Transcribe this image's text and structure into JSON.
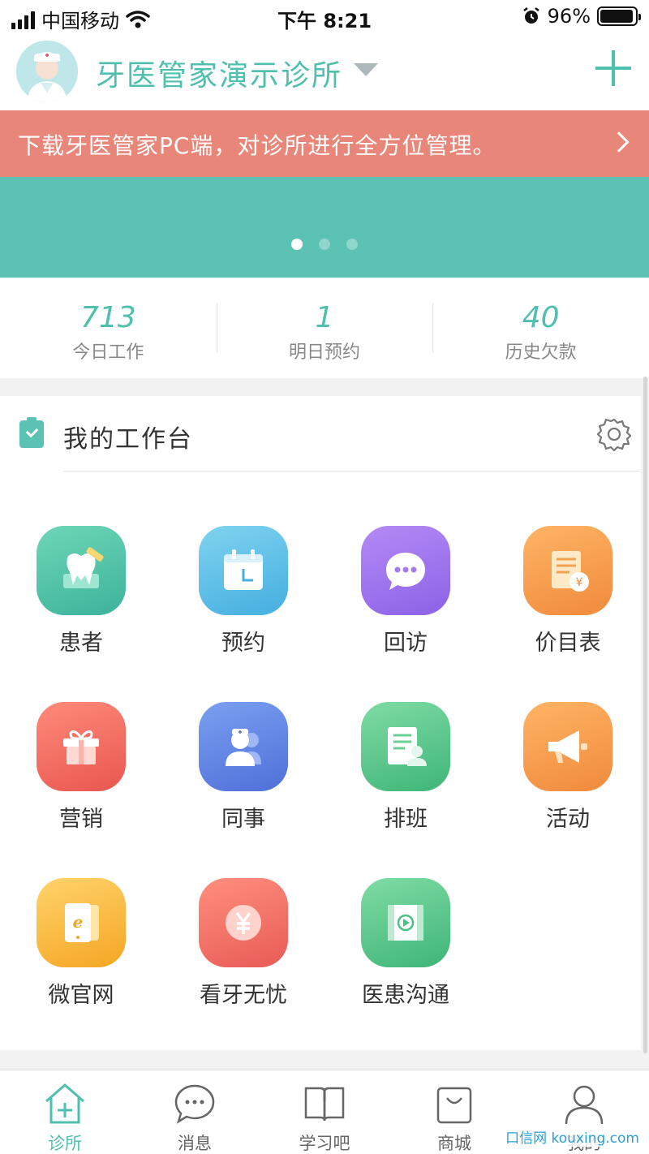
{
  "status_bar": {
    "carrier": "中国移动",
    "time": "下午 8:21",
    "battery": "96%",
    "battery_level": 0.96
  },
  "header": {
    "clinic_name": "牙医管家演示诊所"
  },
  "promo": {
    "text": "下载牙医管家PC端，对诊所进行全方位管理。"
  },
  "carousel": {
    "pages": 3,
    "active_page": 1
  },
  "stats": [
    {
      "value": "713",
      "label": "今日工作"
    },
    {
      "value": "1",
      "label": "明日预约"
    },
    {
      "value": "40",
      "label": "历史欠款"
    }
  ],
  "workbench": {
    "title": "我的工作台",
    "tiles": [
      {
        "label": "患者",
        "icon": "tooth-icon",
        "color": "#3cb39a"
      },
      {
        "label": "预约",
        "icon": "calendar-icon",
        "color": "#45aee0"
      },
      {
        "label": "回访",
        "icon": "chat-bubble-icon",
        "color": "#8c62e8"
      },
      {
        "label": "价目表",
        "icon": "price-list-icon",
        "color": "#f08a3c"
      },
      {
        "label": "营销",
        "icon": "gift-icon",
        "color": "#e8564f"
      },
      {
        "label": "同事",
        "icon": "colleagues-icon",
        "color": "#4f6fd8"
      },
      {
        "label": "排班",
        "icon": "schedule-icon",
        "color": "#3fb578"
      },
      {
        "label": "活动",
        "icon": "megaphone-icon",
        "color": "#f08a3c"
      },
      {
        "label": "微官网",
        "icon": "microsite-icon",
        "color": "#f5a623"
      },
      {
        "label": "看牙无忧",
        "icon": "yuan-icon",
        "color": "#e85b56"
      },
      {
        "label": "医患沟通",
        "icon": "video-icon",
        "color": "#3fb578"
      }
    ]
  },
  "tabbar": [
    {
      "label": "诊所",
      "icon": "clinic-icon",
      "active": true
    },
    {
      "label": "消息",
      "icon": "message-icon",
      "active": false
    },
    {
      "label": "学习吧",
      "icon": "book-icon",
      "active": false
    },
    {
      "label": "商城",
      "icon": "shopping-bag-icon",
      "active": false
    },
    {
      "label": "我的",
      "icon": "profile-icon",
      "active": false
    }
  ],
  "watermark": "口信网 kouxing.com",
  "colors": {
    "accent": "#4fc0ae",
    "promo": "#e9867a",
    "carousel": "#5cc2b3"
  }
}
